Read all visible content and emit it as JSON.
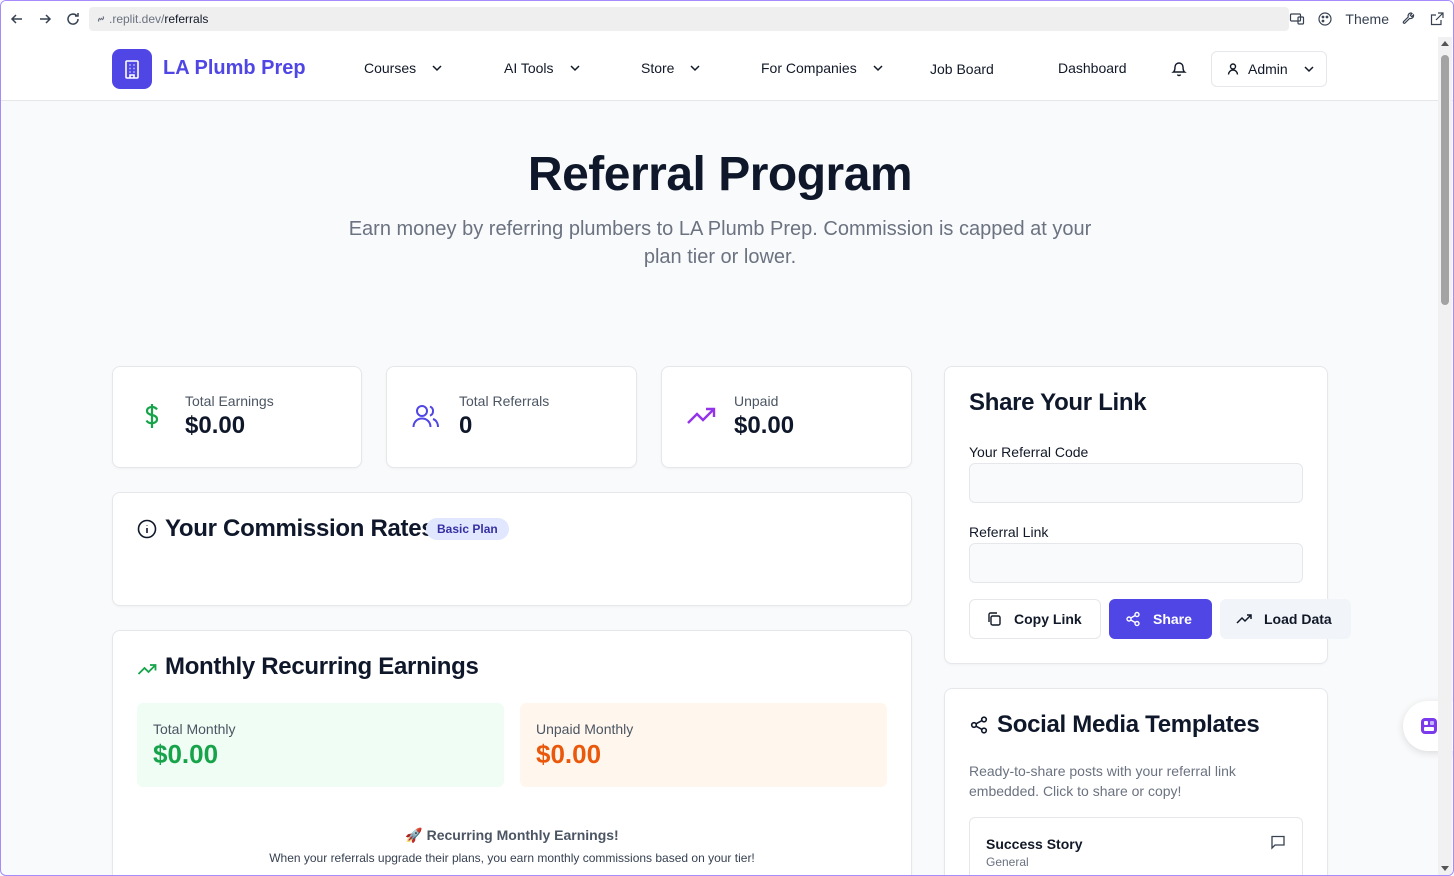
{
  "browser": {
    "url_host": ".replit.dev/",
    "url_path": "referrals",
    "theme_label": "Theme"
  },
  "header": {
    "brand": "LA Plumb Prep",
    "nav": {
      "courses": "Courses",
      "ai_tools": "AI Tools",
      "store": "Store",
      "for_companies": "For Companies",
      "job_board": "Job Board",
      "dashboard": "Dashboard"
    },
    "user_menu": "Admin"
  },
  "hero": {
    "title": "Referral Program",
    "subtitle": "Earn money by referring plumbers to LA Plumb Prep. Commission is capped at your plan tier or lower."
  },
  "stats": {
    "earnings": {
      "label": "Total Earnings",
      "value": "$0.00"
    },
    "referrals": {
      "label": "Total Referrals",
      "value": "0"
    },
    "unpaid": {
      "label": "Unpaid",
      "value": "$0.00"
    }
  },
  "commission": {
    "title": "Your Commission Rates",
    "badge": "Basic Plan"
  },
  "monthly": {
    "title": "Monthly Recurring Earnings",
    "total_label": "Total Monthly",
    "total_value": "$0.00",
    "unpaid_label": "Unpaid Monthly",
    "unpaid_value": "$0.00",
    "recurring_emoji": "🚀",
    "recurring_title": "Recurring Monthly Earnings!",
    "recurring_sub": "When your referrals upgrade their plans, you earn monthly commissions based on your tier!"
  },
  "share": {
    "title": "Share Your Link",
    "code_label": "Your Referral Code",
    "code_value": "",
    "link_label": "Referral Link",
    "link_value": "",
    "copy_button": "Copy Link",
    "share_button": "Share",
    "load_button": "Load Data"
  },
  "social": {
    "title": "Social Media Templates",
    "description": "Ready-to-share posts with your referral link embedded. Click to share or copy!",
    "templates": [
      {
        "title": "Success Story",
        "category": "General"
      }
    ]
  },
  "colors": {
    "accent": "#4f46e5",
    "green": "#16a34a",
    "orange": "#ea580c",
    "purple": "#9333ea"
  }
}
